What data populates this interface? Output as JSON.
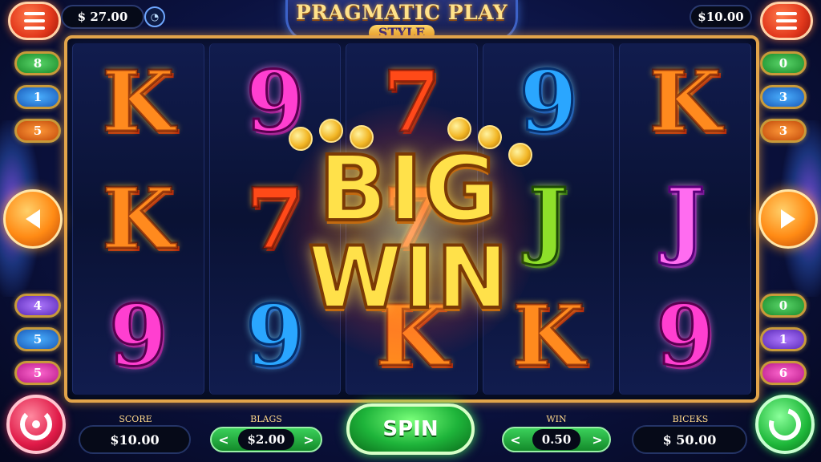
{
  "header": {
    "balance_left": "$ 27.00",
    "balance_right": "$10.00",
    "logo_title": "PRAGMATIC PLAY",
    "logo_subtitle": "STYLE"
  },
  "reels": [
    [
      {
        "symbol": "K",
        "style": "sym-K"
      },
      {
        "symbol": "K",
        "style": "sym-K"
      },
      {
        "symbol": "9",
        "style": "sym-9p"
      }
    ],
    [
      {
        "symbol": "9",
        "style": "sym-9p"
      },
      {
        "symbol": "7",
        "style": "sym-7"
      },
      {
        "symbol": "9",
        "style": "sym-9b"
      }
    ],
    [
      {
        "symbol": "7",
        "style": "sym-7"
      },
      {
        "symbol": "7",
        "style": "sym-7"
      },
      {
        "symbol": "K",
        "style": "sym-K"
      }
    ],
    [
      {
        "symbol": "9",
        "style": "sym-9b"
      },
      {
        "symbol": "J",
        "style": "sym-Jg"
      },
      {
        "symbol": "K",
        "style": "sym-K"
      }
    ],
    [
      {
        "symbol": "K",
        "style": "sym-K"
      },
      {
        "symbol": "J",
        "style": "sym-J"
      },
      {
        "symbol": "9",
        "style": "sym-9p"
      }
    ]
  ],
  "big_win": {
    "line1": "BIG",
    "line2": "WIN"
  },
  "paylines_left": [
    {
      "label": "8",
      "color": "pl-green"
    },
    {
      "label": "1",
      "color": "pl-blue"
    },
    {
      "label": "5",
      "color": "pl-orange"
    },
    {
      "label": "4",
      "color": "pl-purple"
    },
    {
      "label": "5",
      "color": "pl-blue"
    },
    {
      "label": "5",
      "color": "pl-pink"
    }
  ],
  "paylines_right": [
    {
      "label": "0",
      "color": "pl-green"
    },
    {
      "label": "3",
      "color": "pl-blue"
    },
    {
      "label": "3",
      "color": "pl-orange"
    },
    {
      "label": "0",
      "color": "pl-green"
    },
    {
      "label": "1",
      "color": "pl-purple"
    },
    {
      "label": "6",
      "color": "pl-pink"
    }
  ],
  "footer": {
    "score_label": "SCORE",
    "score_value": "$10.00",
    "bet_label": "BLAGS",
    "bet_value": "$2.00",
    "win_label": "WIN",
    "win_value": "0.50",
    "total_label": "BICEKS",
    "total_value": "$ 50.00",
    "spin_label": "SPIN",
    "stepper_prev": "<",
    "stepper_next": ">"
  },
  "colors": {
    "frame_gold": "#e2a44a",
    "spin_green": "#1eb43a",
    "bigwin_yellow": "#ffe14a"
  }
}
